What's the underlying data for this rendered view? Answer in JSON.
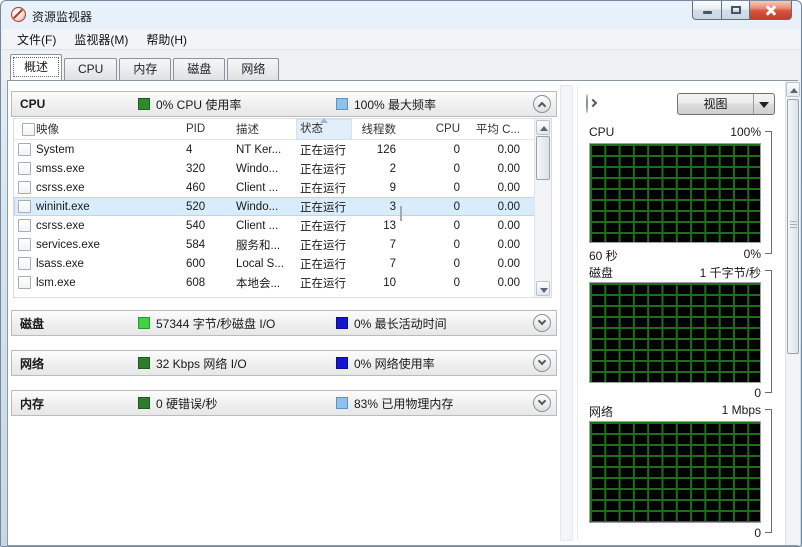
{
  "window": {
    "title": "资源监视器"
  },
  "menu_bar": {
    "items": [
      "文件(F)",
      "监视器(M)",
      "帮助(H)"
    ]
  },
  "tab_bar": {
    "active_tab": "概述",
    "tabs": [
      "概述",
      "CPU",
      "内存",
      "磁盘",
      "网络"
    ]
  },
  "overview": {
    "cpu": {
      "title": "CPU",
      "legend_green": "0% CPU 使用率",
      "legend_blue": "100% 最大频率"
    },
    "disk": {
      "title": "磁盘",
      "legend_green": "57344 字节/秒磁盘 I/O",
      "legend_blue": "0% 最长活动时间"
    },
    "network": {
      "title": "网络",
      "legend_green": "32 Kbps 网络 I/O",
      "legend_blue": "0% 网络使用率"
    },
    "memory": {
      "title": "内存",
      "legend_green": "0 硬错误/秒",
      "legend_blue": "83% 已用物理内存"
    }
  },
  "process_table": {
    "headers": {
      "image": "映像",
      "pid": "PID",
      "desc": "描述",
      "status": "状态",
      "threads": "线程数",
      "cpu": "CPU",
      "avg_cpu": "平均 C..."
    },
    "rows": [
      {
        "image": "System",
        "pid": "4",
        "desc": "NT Ker...",
        "status": "正在运行",
        "threads": "126",
        "cpu": "0",
        "avg_cpu": "0.00"
      },
      {
        "image": "smss.exe",
        "pid": "320",
        "desc": "Windo...",
        "status": "正在运行",
        "threads": "2",
        "cpu": "0",
        "avg_cpu": "0.00"
      },
      {
        "image": "csrss.exe",
        "pid": "460",
        "desc": "Client ...",
        "status": "正在运行",
        "threads": "9",
        "cpu": "0",
        "avg_cpu": "0.00"
      },
      {
        "image": "wininit.exe",
        "pid": "520",
        "desc": "Windo...",
        "status": "正在运行",
        "threads": "3",
        "cpu": "0",
        "avg_cpu": "0.00",
        "selected": true
      },
      {
        "image": "csrss.exe",
        "pid": "540",
        "desc": "Client ...",
        "status": "正在运行",
        "threads": "13",
        "cpu": "0",
        "avg_cpu": "0.00"
      },
      {
        "image": "services.exe",
        "pid": "584",
        "desc": "服务和...",
        "status": "正在运行",
        "threads": "7",
        "cpu": "0",
        "avg_cpu": "0.00"
      },
      {
        "image": "lsass.exe",
        "pid": "600",
        "desc": "Local S...",
        "status": "正在运行",
        "threads": "7",
        "cpu": "0",
        "avg_cpu": "0.00"
      },
      {
        "image": "lsm.exe",
        "pid": "608",
        "desc": "本地会...",
        "status": "正在运行",
        "threads": "10",
        "cpu": "0",
        "avg_cpu": "0.00"
      }
    ]
  },
  "right_panel": {
    "view_button": "视图",
    "graphs": [
      {
        "title": "CPU",
        "scale_top": "100%",
        "bottom_left": "60 秒",
        "bottom_right": "0%"
      },
      {
        "title": "磁盘",
        "scale_top": "1 千字节/秒",
        "bottom_left": "",
        "bottom_right": "0"
      },
      {
        "title": "网络",
        "scale_top": "1 Mbps",
        "bottom_left": "",
        "bottom_right": "0"
      }
    ]
  },
  "colors": {
    "cpu_green": "#2e8b2e",
    "cpu_blue": "#8ec2ec",
    "disk_green": "#3fd43f",
    "disk_blue": "#1515cf",
    "net_green": "#2e7d2e",
    "net_blue": "#1515cf",
    "mem_green": "#2e7d2e",
    "mem_blue": "#8ec2ec",
    "graph_bg": "#000000",
    "graph_grid": "#1e6e1e",
    "selection": "#d9ecfb"
  }
}
